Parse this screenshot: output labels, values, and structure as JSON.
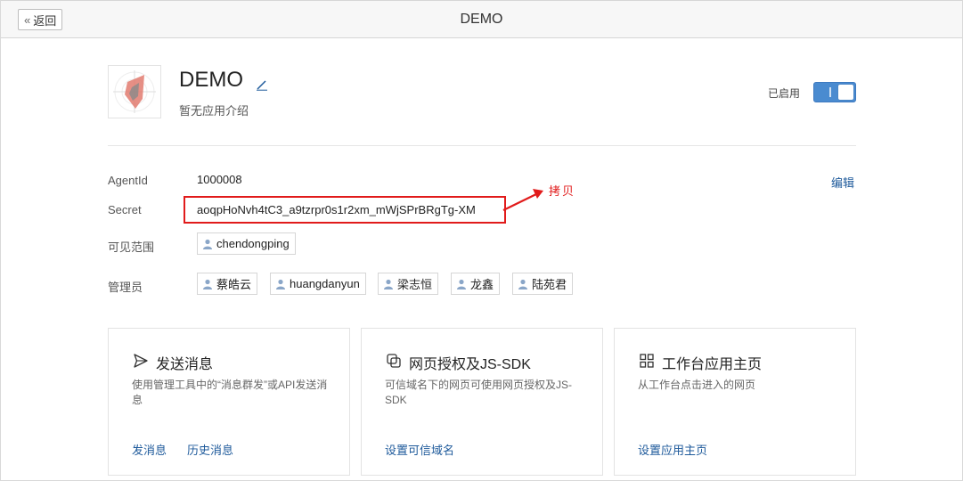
{
  "header": {
    "back_label": "返回",
    "title": "DEMO"
  },
  "app": {
    "name": "DEMO",
    "description": "暂无应用介绍",
    "status_label": "已启用",
    "enabled": true
  },
  "details": {
    "agentid_label": "AgentId",
    "agentid_value": "1000008",
    "secret_label": "Secret",
    "secret_value": "aoqpHoNvh4tC3_a9tzrpr0s1r2xm_mWjSPrBRgTg-XM",
    "copy_annotation": "拷贝",
    "edit_label": "编辑",
    "visibility_label": "可见范围",
    "visibility_users": [
      "chendongping"
    ],
    "admins_label": "管理员",
    "admins": [
      "蔡皓云",
      "huangdanyun",
      "梁志恒",
      "龙鑫",
      "陆苑君"
    ]
  },
  "cards": [
    {
      "icon": "send-icon",
      "title": "发送消息",
      "description": "使用管理工具中的“消息群发”或API发送消息",
      "links": [
        "发消息",
        "历史消息"
      ]
    },
    {
      "icon": "web-auth-icon",
      "title": "网页授权及JS-SDK",
      "description": "可信域名下的网页可使用网页授权及JS-SDK",
      "links": [
        "设置可信域名"
      ]
    },
    {
      "icon": "grid-icon",
      "title": "工作台应用主页",
      "description": "从工作台点击进入的网页",
      "links": [
        "设置应用主页"
      ]
    }
  ],
  "colors": {
    "accent": "#4a8bd0",
    "link": "#1e5a9b",
    "highlight": "#e11b1b"
  }
}
